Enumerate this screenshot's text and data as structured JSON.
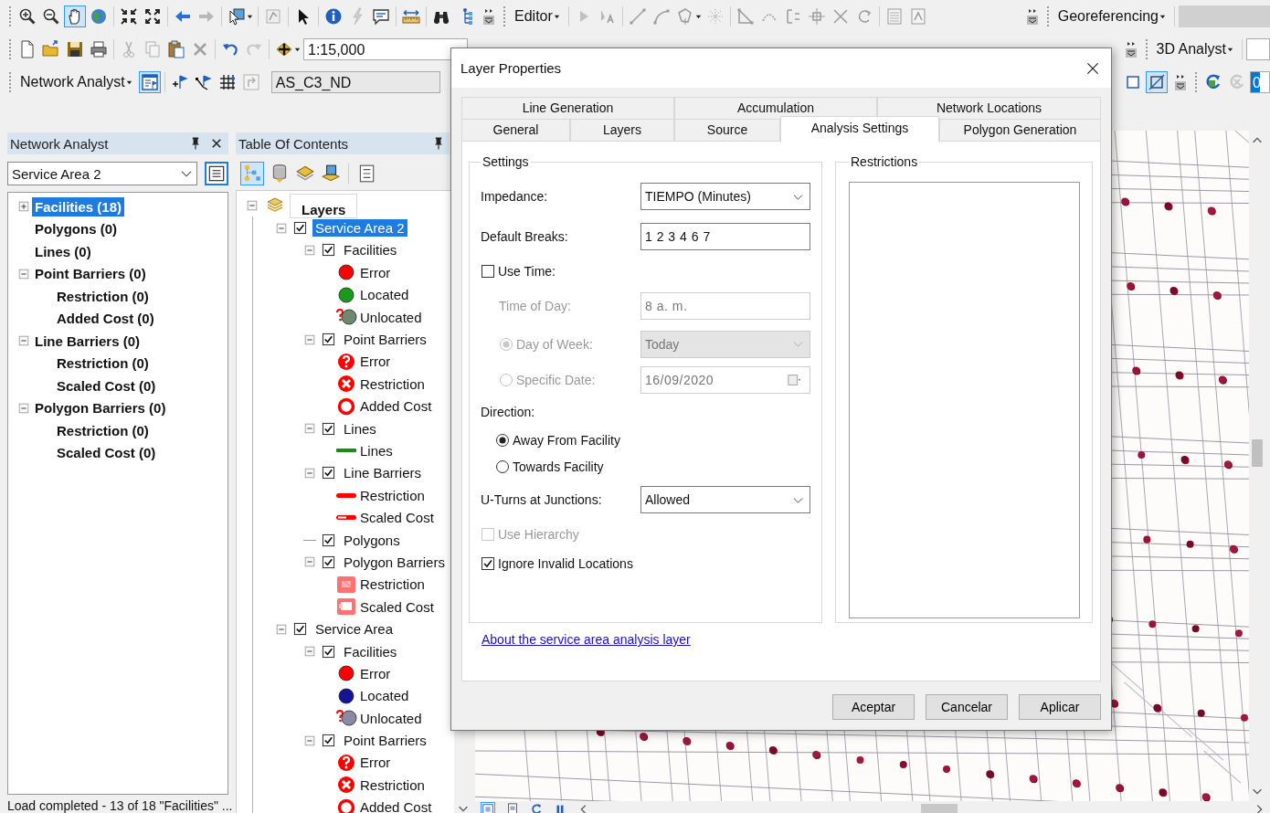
{
  "toolbar": {
    "editor_menu": "Editor",
    "georeferencing_menu": "Georeferencing",
    "scale": "1:15,000",
    "analyst_3d_menu": "3D Analyst",
    "network_analyst_menu": "Network Analyst",
    "network_dataset": "AS_C3_ND",
    "field_3d": "0",
    "pan_tool_active": true,
    "na_window_active": true,
    "square_tool_active": true
  },
  "network_analyst": {
    "title": "Network Analyst",
    "layer": "Service Area 2",
    "tree": [
      {
        "label": "Facilities (18)",
        "selected": true,
        "expanded": false
      },
      {
        "label": "Polygons (0)",
        "selected": false
      },
      {
        "label": "Lines (0)",
        "selected": false
      },
      {
        "label": "Point Barriers (0)",
        "selected": false,
        "expanded": true,
        "children": [
          {
            "label": "Restriction (0)",
            "selected": false
          },
          {
            "label": "Added Cost (0)",
            "selected": false
          }
        ]
      },
      {
        "label": "Line Barriers (0)",
        "selected": false,
        "expanded": true,
        "children": [
          {
            "label": "Restriction (0)",
            "selected": false
          },
          {
            "label": "Scaled Cost (0)",
            "selected": false
          }
        ]
      },
      {
        "label": "Polygon Barriers (0)",
        "selected": false,
        "expanded": true,
        "children": [
          {
            "label": "Restriction (0)",
            "selected": false
          },
          {
            "label": "Scaled Cost (0)",
            "selected": false
          }
        ]
      }
    ],
    "status": "Load completed - 13 of 18 \"Facilities\" ..."
  },
  "table_of_contents": {
    "title": "Table Of Contents",
    "list_by_drawing_order_active": true,
    "tree": [
      {
        "kind": "group",
        "label": "Layers",
        "expanded": true,
        "children": [
          {
            "kind": "layer",
            "label": "Service Area 2",
            "checked": true,
            "selected": true,
            "expanded": true,
            "children": [
              {
                "kind": "layer",
                "label": "Facilities",
                "checked": true,
                "selected": false,
                "expanded": true,
                "children": [
                  {
                    "kind": "dot",
                    "label": "Error",
                    "color": "#ff0000"
                  },
                  {
                    "kind": "dot",
                    "label": "Located",
                    "color": "#1a9a1a"
                  },
                  {
                    "kind": "unlocated-dot",
                    "label": "Unlocated",
                    "color": "#6e8a6e"
                  }
                ]
              },
              {
                "kind": "layer",
                "label": "Point Barriers",
                "checked": true,
                "selected": false,
                "expanded": true,
                "children": [
                  {
                    "kind": "error-marker",
                    "label": "Error"
                  },
                  {
                    "kind": "restriction-marker",
                    "label": "Restriction"
                  },
                  {
                    "kind": "added-cost-marker",
                    "label": "Added Cost"
                  }
                ]
              },
              {
                "kind": "layer",
                "label": "Lines",
                "checked": true,
                "selected": false,
                "expanded": true,
                "children": [
                  {
                    "kind": "line-symbol",
                    "label": "Lines",
                    "color": "#1a8a1a"
                  }
                ]
              },
              {
                "kind": "layer",
                "label": "Line Barriers",
                "checked": true,
                "selected": false,
                "expanded": true,
                "children": [
                  {
                    "kind": "restriction-line",
                    "label": "Restriction"
                  },
                  {
                    "kind": "scaled-cost-line",
                    "label": "Scaled Cost"
                  }
                ]
              },
              {
                "kind": "layer",
                "label": "Polygons",
                "checked": true,
                "selected": false
              },
              {
                "kind": "layer",
                "label": "Polygon Barriers",
                "checked": true,
                "selected": false,
                "expanded": true,
                "children": [
                  {
                    "kind": "restriction-fill",
                    "label": "Restriction"
                  },
                  {
                    "kind": "scaled-cost-fill",
                    "label": "Scaled Cost"
                  }
                ]
              }
            ]
          },
          {
            "kind": "layer",
            "label": "Service Area",
            "checked": true,
            "selected": false,
            "expanded": true,
            "children": [
              {
                "kind": "layer",
                "label": "Facilities",
                "checked": true,
                "selected": false,
                "expanded": true,
                "children": [
                  {
                    "kind": "dot",
                    "label": "Error",
                    "color": "#ff0000"
                  },
                  {
                    "kind": "dot",
                    "label": "Located",
                    "color": "#141496"
                  },
                  {
                    "kind": "unlocated-dot",
                    "label": "Unlocated",
                    "color": "#8a8aa8"
                  }
                ]
              },
              {
                "kind": "layer",
                "label": "Point Barriers",
                "checked": true,
                "selected": false,
                "expanded": true,
                "children": [
                  {
                    "kind": "error-marker",
                    "label": "Error"
                  },
                  {
                    "kind": "restriction-marker",
                    "label": "Restriction"
                  },
                  {
                    "kind": "added-cost-marker",
                    "label": "Added Cost"
                  }
                ]
              }
            ]
          }
        ]
      }
    ]
  },
  "dialog": {
    "title": "Layer Properties",
    "tab_rows": [
      [
        {
          "label": "Line Generation",
          "selected": false
        },
        {
          "label": "Accumulation",
          "selected": false
        },
        {
          "label": "Network Locations",
          "selected": false
        }
      ],
      [
        {
          "label": "General",
          "selected": false
        },
        {
          "label": "Layers",
          "selected": false
        },
        {
          "label": "Source",
          "selected": false
        },
        {
          "label": "Analysis Settings",
          "selected": true
        },
        {
          "label": "Polygon Generation",
          "selected": false
        }
      ]
    ],
    "settings": {
      "title": "Settings",
      "rows": [
        {
          "kind": "select",
          "label": "Impedance:",
          "value": "TIEMPO (Minutes)",
          "disabled": false
        },
        {
          "kind": "text",
          "label": "Default Breaks:",
          "value": "1 2 3 4 6 7",
          "disabled": false
        },
        {
          "kind": "checkbox",
          "label": "Use Time:",
          "checked": false,
          "disabled": false
        },
        {
          "kind": "text",
          "label": "Time of Day:",
          "value": "8 a. m.",
          "disabled": true
        },
        {
          "kind": "radio-select",
          "label": "Day of Week:",
          "selected": true,
          "value": "Today",
          "disabled": true
        },
        {
          "kind": "radio-date",
          "label": "Specific Date:",
          "selected": false,
          "value": "16/09/2020",
          "disabled": true
        },
        {
          "kind": "heading",
          "label": "Direction:"
        },
        {
          "kind": "radio",
          "label": "Away From Facility",
          "selected": true,
          "disabled": false
        },
        {
          "kind": "radio",
          "label": "Towards Facility",
          "selected": false,
          "disabled": false
        },
        {
          "kind": "select",
          "label": "U-Turns at Junctions:",
          "value": "Allowed",
          "disabled": false
        },
        {
          "kind": "checkbox",
          "label": "Use Hierarchy",
          "checked": false,
          "disabled": true
        },
        {
          "kind": "checkbox",
          "label": "Ignore Invalid Locations",
          "checked": true,
          "disabled": false
        }
      ]
    },
    "restrictions": {
      "title": "Restrictions"
    },
    "link": "About the service area analysis layer",
    "buttons": [
      "Aceptar",
      "Cancelar",
      "Aplicar"
    ]
  }
}
